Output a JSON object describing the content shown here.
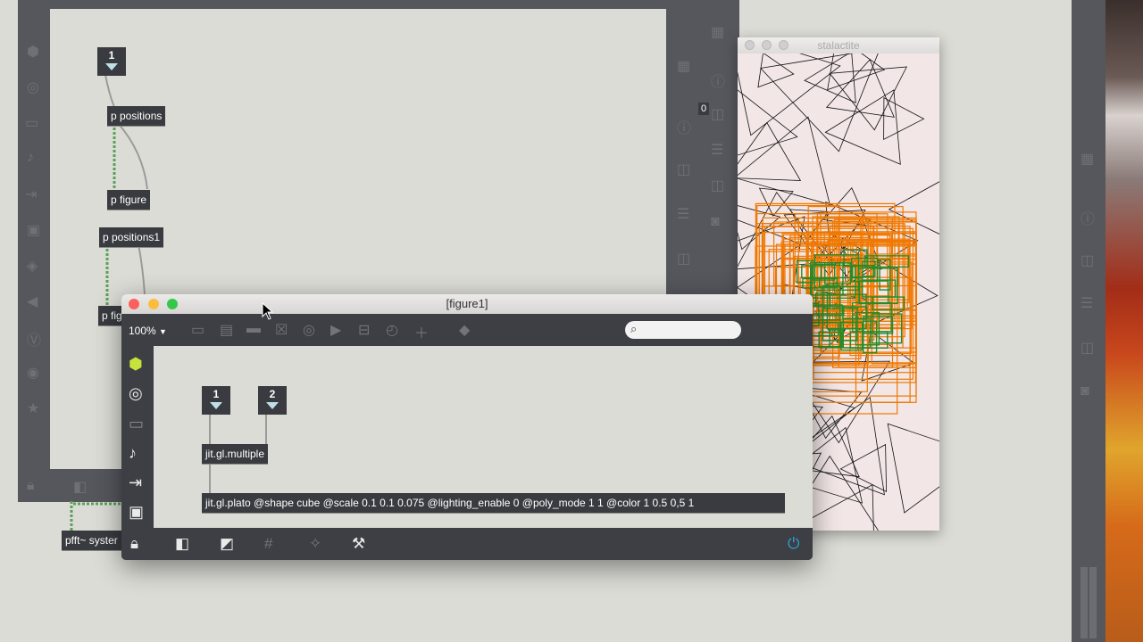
{
  "back_patcher": {
    "number_box": "1",
    "objects": {
      "positions": "p positions",
      "figure": "p figure",
      "positions1": "p positions1",
      "figure_partial": "p fig",
      "pfft_partial": "pfft~ syster"
    },
    "right_partial_text": "0"
  },
  "figure_window": {
    "title": "[figure1]",
    "zoom": "100%",
    "number_box_1": "1",
    "number_box_2": "2",
    "multiple_object": "jit.gl.multiple",
    "plato_object": "jit.gl.plato @shape cube @scale 0.1 0.1 0.075 @lighting_enable 0 @poly_mode 1 1 @color 1 0.5 0,5 1",
    "toolbar_icons": [
      "patcher-icon",
      "comment-icon",
      "speech-icon",
      "close-box-icon",
      "target-icon",
      "play-icon",
      "minus-icon",
      "timer-icon",
      "plus-icon",
      "paint-icon"
    ],
    "left_icons": [
      "cube-icon",
      "circle-icon",
      "keyboard-icon",
      "note-icon",
      "sequence-icon",
      "image-icon"
    ],
    "bottom_icons": [
      "lock-icon",
      "windows-icon",
      "presentation-icon",
      "grid-icon",
      "snap-icon",
      "wrench-icon",
      "power-icon"
    ],
    "colors": {
      "accent_power": "#2aa7d8",
      "cube": "#c8e23c",
      "close": "#fc605c",
      "min": "#fdbc40",
      "max": "#34c84a"
    }
  },
  "stalactite_window": {
    "title": "stalactite",
    "colors": {
      "background": "#f2e6e6",
      "orange": "#f07800",
      "green": "#2a8a28",
      "line": "#111111"
    }
  }
}
